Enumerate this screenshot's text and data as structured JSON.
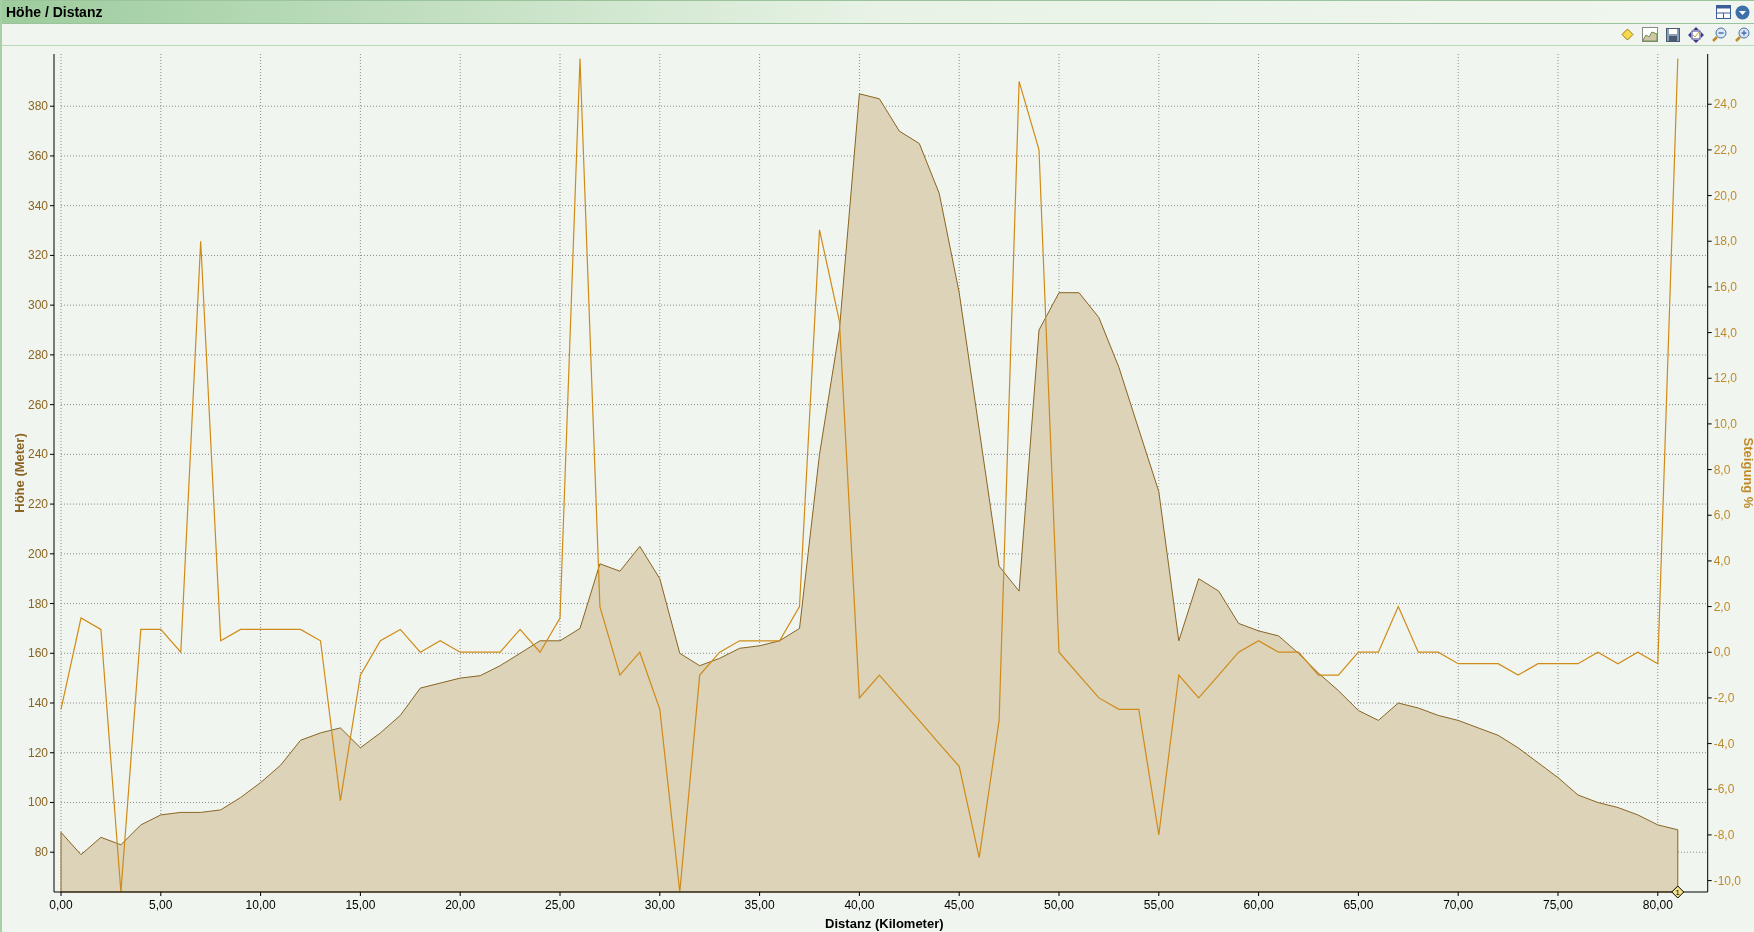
{
  "panel": {
    "title": "Höhe / Distanz"
  },
  "chart": {
    "chart_data": {
      "type": "area",
      "xlabel": "Distanz (Kilometer)",
      "ylabel": "Höhe (Meter)",
      "y2label": "Steigung %",
      "x": [
        0,
        1,
        2,
        3,
        4,
        5,
        6,
        7,
        8,
        9,
        10,
        11,
        12,
        13,
        14,
        15,
        16,
        17,
        18,
        19,
        20,
        21,
        22,
        23,
        24,
        25,
        26,
        27,
        28,
        29,
        30,
        31,
        32,
        33,
        34,
        35,
        36,
        37,
        38,
        39,
        40,
        41,
        42,
        43,
        44,
        45,
        46,
        47,
        48,
        49,
        50,
        51,
        52,
        53,
        54,
        55,
        56,
        57,
        58,
        59,
        60,
        61,
        62,
        63,
        64,
        65,
        66,
        67,
        68,
        69,
        70,
        71,
        72,
        73,
        74,
        75,
        76,
        77,
        78,
        79,
        80,
        81
      ],
      "grid": true,
      "xlim": [
        0,
        82.5
      ],
      "ylim": [
        64,
        401
      ],
      "y2lim": [
        -10.5,
        26.2
      ],
      "xticks": [
        {
          "value": 0,
          "label": "0,00"
        },
        {
          "value": 5,
          "label": "5,00"
        },
        {
          "value": 10,
          "label": "10,00"
        },
        {
          "value": 15,
          "label": "15,00"
        },
        {
          "value": 20,
          "label": "20,00"
        },
        {
          "value": 25,
          "label": "25,00"
        },
        {
          "value": 30,
          "label": "30,00"
        },
        {
          "value": 35,
          "label": "35,00"
        },
        {
          "value": 40,
          "label": "40,00"
        },
        {
          "value": 45,
          "label": "45,00"
        },
        {
          "value": 50,
          "label": "50,00"
        },
        {
          "value": 55,
          "label": "55,00"
        },
        {
          "value": 60,
          "label": "60,00"
        },
        {
          "value": 65,
          "label": "65,00"
        },
        {
          "value": 70,
          "label": "70,00"
        },
        {
          "value": 75,
          "label": "75,00"
        },
        {
          "value": 80,
          "label": "80,00"
        }
      ],
      "yticks": [
        80,
        100,
        120,
        140,
        160,
        180,
        200,
        220,
        240,
        260,
        280,
        300,
        320,
        340,
        360,
        380
      ],
      "y2ticks": [
        {
          "value": -10,
          "label": "-10,0"
        },
        {
          "value": -8,
          "label": "-8,0"
        },
        {
          "value": -6,
          "label": "-6,0"
        },
        {
          "value": -4,
          "label": "-4,0"
        },
        {
          "value": -2,
          "label": "-2,0"
        },
        {
          "value": 0,
          "label": "0,0"
        },
        {
          "value": 2,
          "label": "2,0"
        },
        {
          "value": 4,
          "label": "4,0"
        },
        {
          "value": 6,
          "label": "6,0"
        },
        {
          "value": 8,
          "label": "8,0"
        },
        {
          "value": 10,
          "label": "10,0"
        },
        {
          "value": 12,
          "label": "12,0"
        },
        {
          "value": 14,
          "label": "14,0"
        },
        {
          "value": 16,
          "label": "16,0"
        },
        {
          "value": 18,
          "label": "18,0"
        },
        {
          "value": 20,
          "label": "20,0"
        },
        {
          "value": 22,
          "label": "22,0"
        },
        {
          "value": 24,
          "label": "24,0"
        }
      ],
      "series": [
        {
          "color": "#8a6422",
          "values": [
            88,
            79,
            86,
            83,
            91,
            95,
            96,
            96,
            97,
            102,
            108,
            115,
            125,
            128,
            130,
            122,
            128,
            135,
            146,
            148,
            150,
            151,
            155,
            160,
            165,
            165,
            170,
            196,
            193,
            203,
            190,
            160,
            155,
            158,
            162,
            163,
            165,
            170,
            240,
            290,
            385,
            383,
            370,
            365,
            345,
            305,
            250,
            195,
            185,
            290,
            305,
            305,
            295,
            275,
            250,
            225,
            165,
            190,
            185,
            172,
            169,
            167,
            160,
            152,
            145,
            137,
            133,
            140,
            138,
            135,
            133,
            130,
            127,
            122,
            116,
            110,
            103,
            100,
            98,
            95,
            91,
            89
          ]
        },
        {
          "type": "line",
          "axis": "y2",
          "color": "#d08a18",
          "values": [
            -2.5,
            1.5,
            1.0,
            -10.5,
            1.0,
            1.0,
            0.0,
            18.0,
            0.5,
            1.0,
            1.0,
            1.0,
            1.0,
            0.5,
            -6.5,
            -1.0,
            0.5,
            1.0,
            0.0,
            0.5,
            0.0,
            0.0,
            0.0,
            1.0,
            0.0,
            1.5,
            26.0,
            2.0,
            -1.0,
            0.0,
            -2.5,
            -10.5,
            -1.0,
            0.0,
            0.5,
            0.5,
            0.5,
            2.0,
            18.5,
            14.5,
            -2.0,
            -1.0,
            -2.0,
            -3.0,
            -4.0,
            -5.0,
            -9.0,
            -3.0,
            25.0,
            22.0,
            0.0,
            -1.0,
            -2.0,
            -2.5,
            -2.5,
            -8.0,
            -1.0,
            -2.0,
            -1.0,
            0.0,
            0.5,
            0.0,
            0.0,
            -1.0,
            -1.0,
            0.0,
            0.0,
            2.0,
            0.0,
            0.0,
            -0.5,
            -0.5,
            -0.5,
            -1.0,
            -0.5,
            -0.5,
            -0.5,
            0.0,
            -0.5,
            0.0,
            -0.5,
            26.0
          ]
        }
      ],
      "annotations": [
        {
          "x": 81,
          "text": "1"
        }
      ]
    }
  }
}
